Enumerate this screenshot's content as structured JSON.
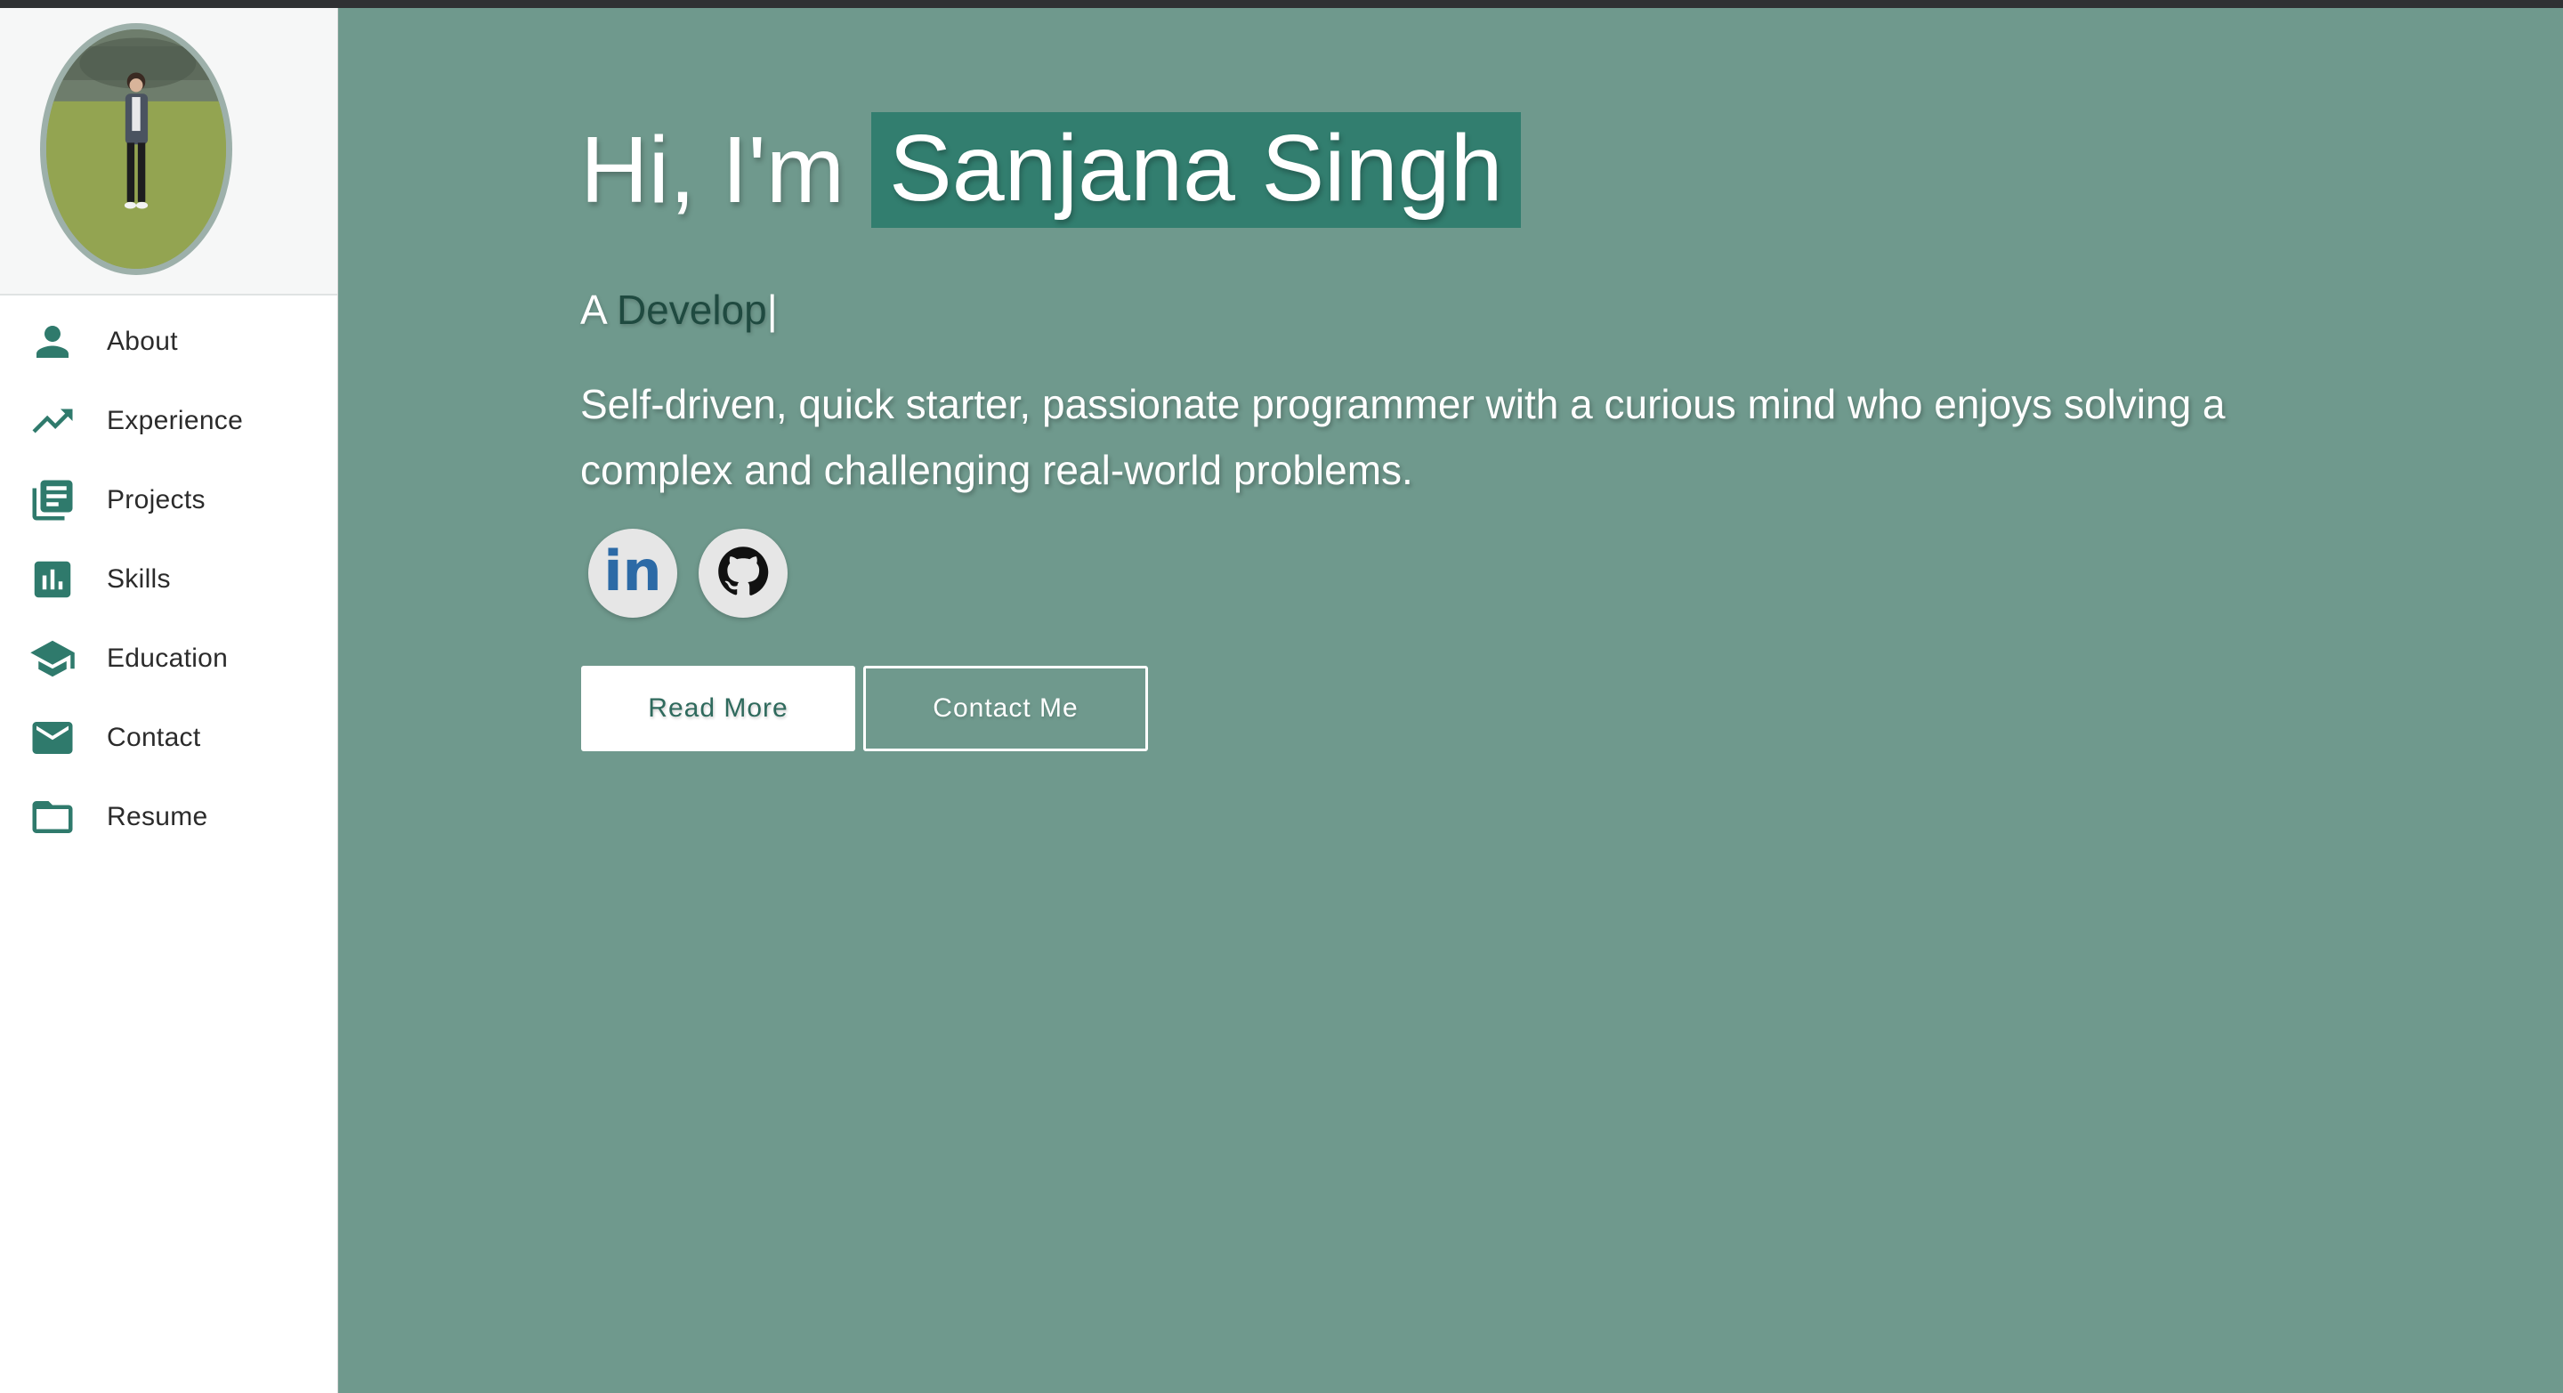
{
  "theme": {
    "accent": "#327e6f",
    "main_bg": "#6f998d",
    "icon_color": "#2f7a6c"
  },
  "profile": {
    "avatar_alt": "profile-photo"
  },
  "sidebar": {
    "items": [
      {
        "label": "About",
        "icon": "person-icon"
      },
      {
        "label": "Experience",
        "icon": "trending-up-icon"
      },
      {
        "label": "Projects",
        "icon": "library-books-icon"
      },
      {
        "label": "Skills",
        "icon": "bar-chart-icon"
      },
      {
        "label": "Education",
        "icon": "graduation-cap-icon"
      },
      {
        "label": "Contact",
        "icon": "email-icon"
      },
      {
        "label": "Resume",
        "icon": "folder-icon"
      }
    ]
  },
  "hero": {
    "greeting": "Hi, I'm",
    "name": "Sanjana Singh",
    "tagline_prefix": "A ",
    "tagline_typed": "Develop",
    "tagline_cursor": "|",
    "summary": "Self-driven, quick starter, passionate programmer with a curious mind who enjoys solving a complex and challenging real-world problems.",
    "social": [
      {
        "name": "linkedin-icon",
        "text": "in"
      },
      {
        "name": "github-icon"
      }
    ],
    "buttons": {
      "read_more": "Read More",
      "contact_me": "Contact Me"
    }
  }
}
